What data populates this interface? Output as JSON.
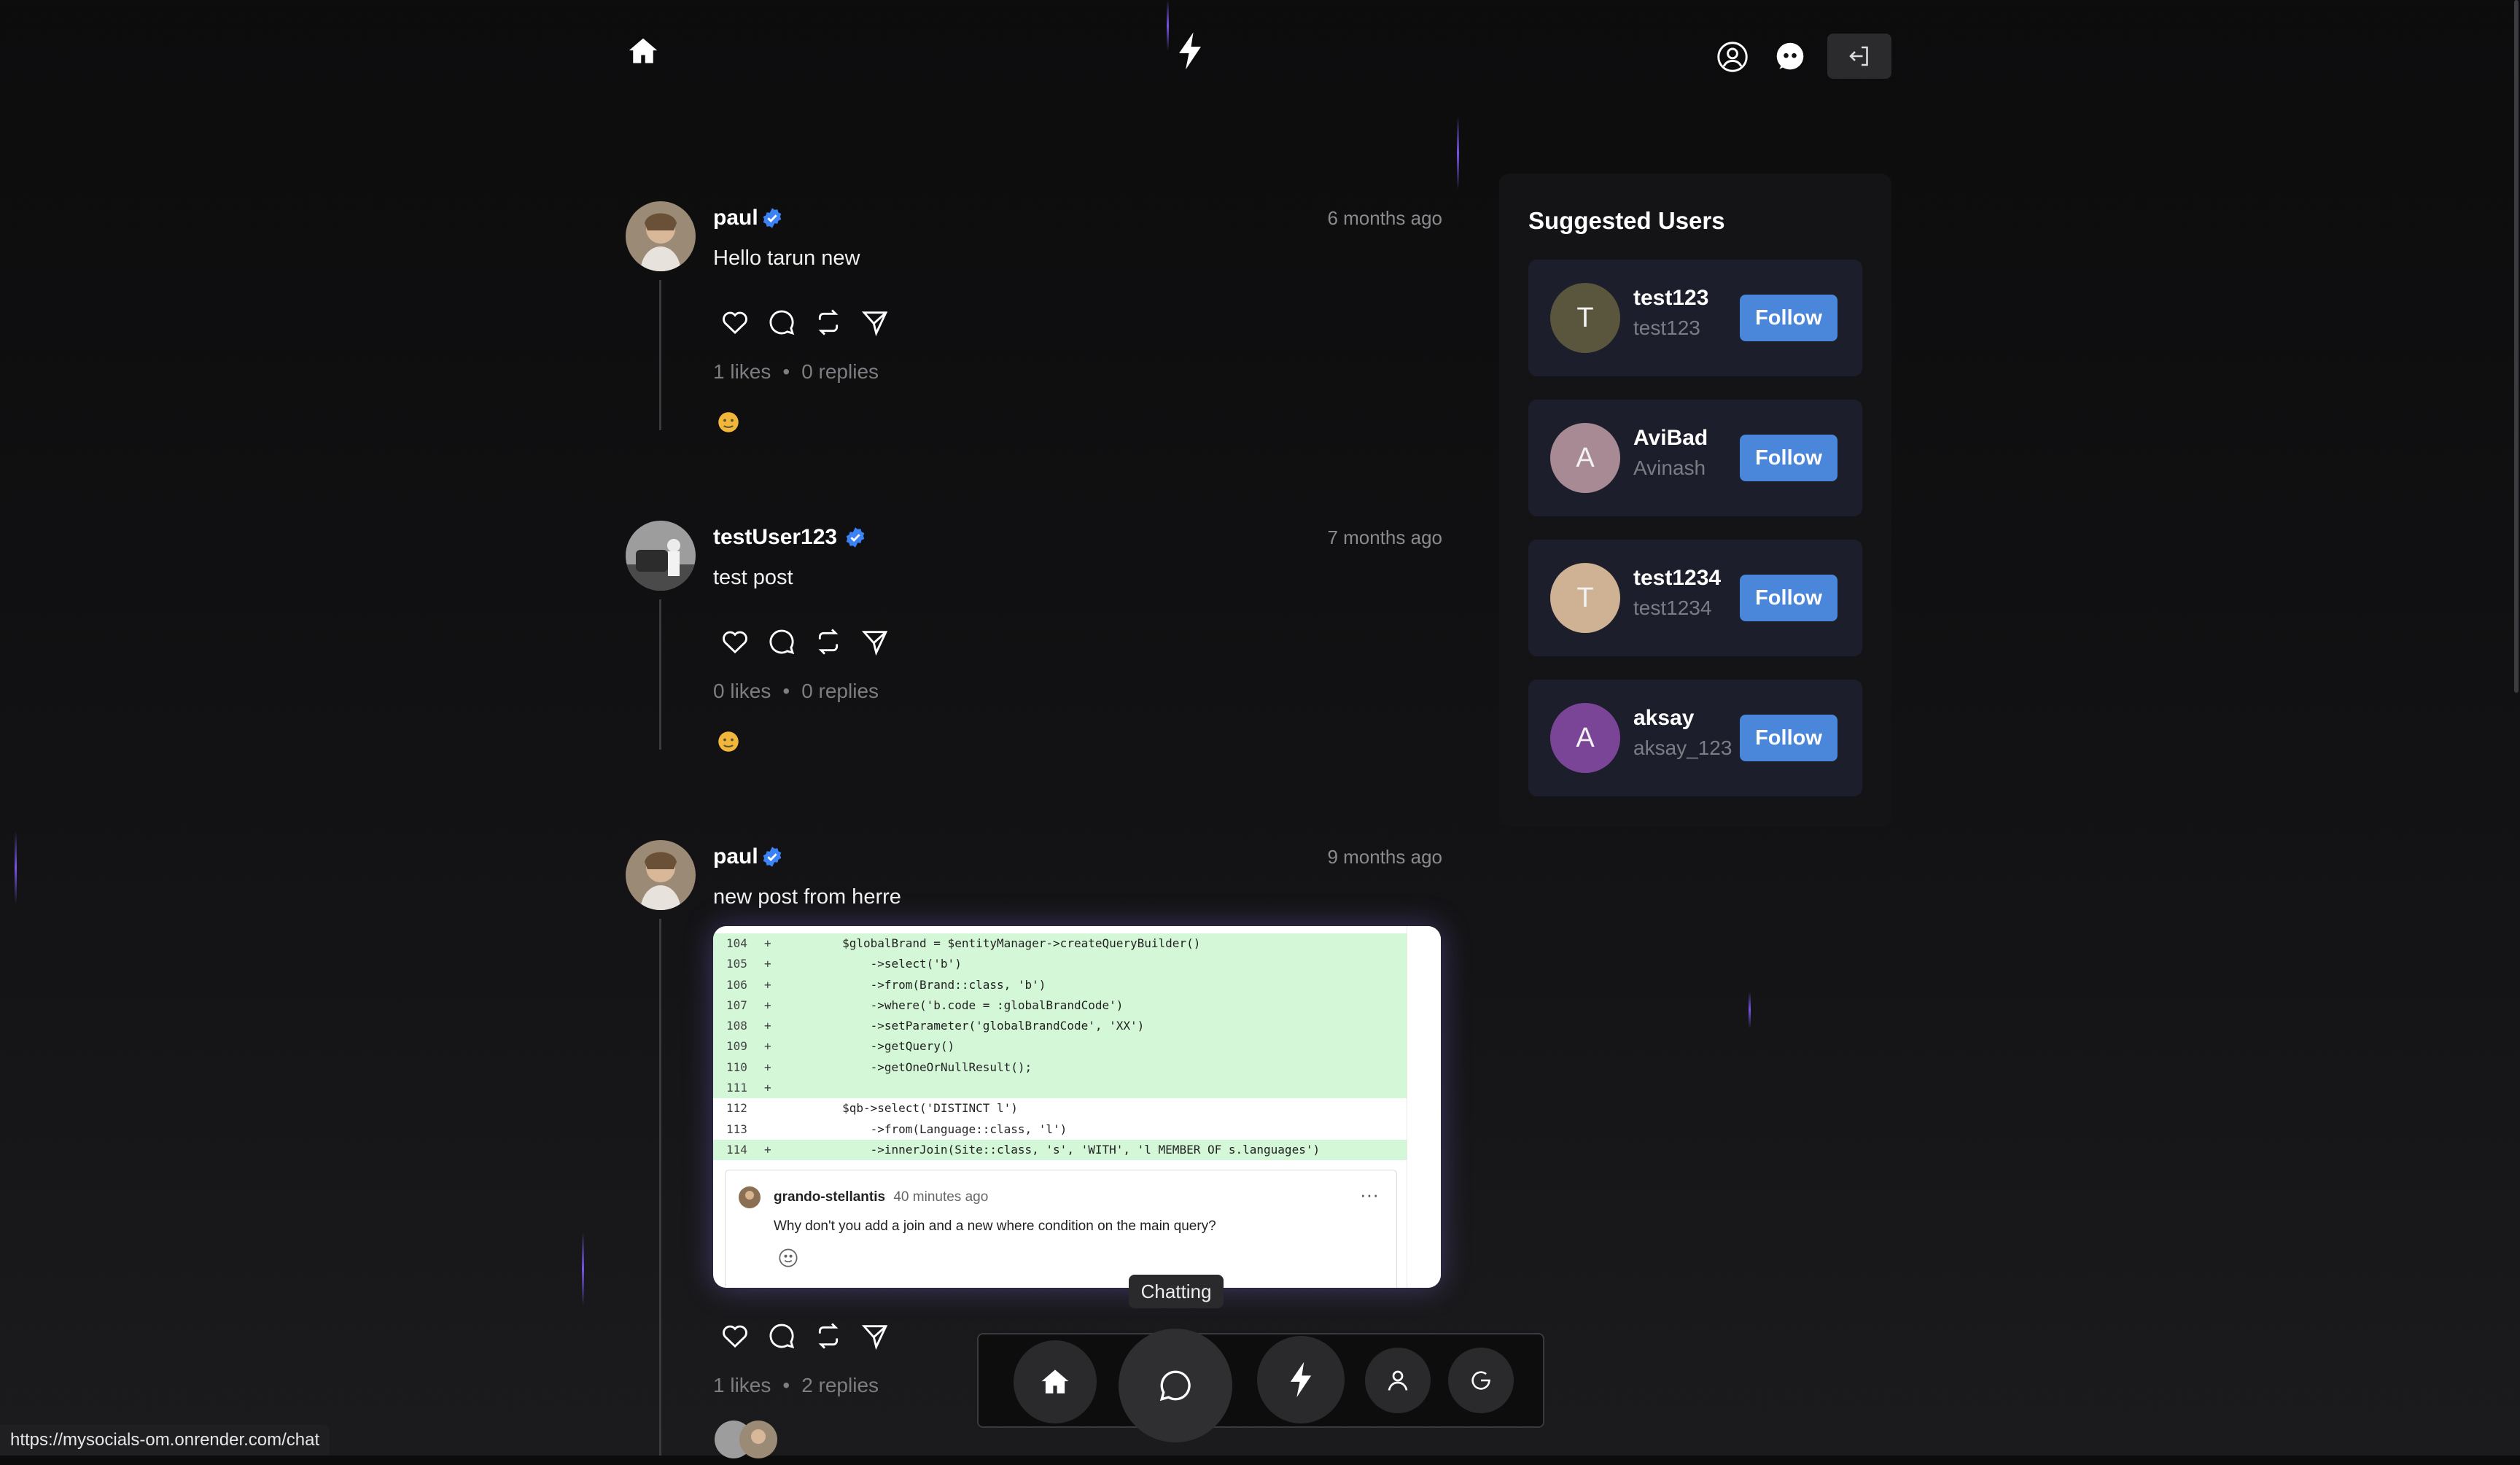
{
  "header": {
    "home_icon": "home-icon",
    "logo_icon": "lightning-icon",
    "profile_icon": "user-circle-icon",
    "chat_icon": "chat-bubbles-icon",
    "logout_icon": "logout-icon"
  },
  "posts": [
    {
      "username": "paul",
      "time": "6 months ago",
      "text": "Hello tarun new",
      "likes": "1 likes",
      "replies": "0 replies"
    },
    {
      "username": "testUser123",
      "time": "7 months ago",
      "text": "test post",
      "likes": "0 likes",
      "replies": "0 replies"
    },
    {
      "username": "paul",
      "time": "9 months ago",
      "text": "new post from herre",
      "likes": "1 likes",
      "replies": "2 replies",
      "image": {
        "code_lines": [
          {
            "n": "104",
            "pm": "+",
            "add": true,
            "code": "        $globalBrand = $entityManager->createQueryBuilder()"
          },
          {
            "n": "105",
            "pm": "+",
            "add": true,
            "code": "            ->select('b')"
          },
          {
            "n": "106",
            "pm": "+",
            "add": true,
            "code": "            ->from(Brand::class, 'b')"
          },
          {
            "n": "107",
            "pm": "+",
            "add": true,
            "code": "            ->where('b.code = :globalBrandCode')"
          },
          {
            "n": "108",
            "pm": "+",
            "add": true,
            "code": "            ->setParameter('globalBrandCode', 'XX')"
          },
          {
            "n": "109",
            "pm": "+",
            "add": true,
            "code": "            ->getQuery()"
          },
          {
            "n": "110",
            "pm": "+",
            "add": true,
            "code": "            ->getOneOrNullResult();"
          },
          {
            "n": "111",
            "pm": "+",
            "add": true,
            "code": ""
          },
          {
            "n": "112",
            "pm": "",
            "add": false,
            "code": "        $qb->select('DISTINCT l')"
          },
          {
            "n": "113",
            "pm": "",
            "add": false,
            "code": "            ->from(Language::class, 'l')"
          },
          {
            "n": "114",
            "pm": "+",
            "add": true,
            "code": "            ->innerJoin(Site::class, 's', 'WITH', 'l MEMBER OF s.languages')"
          }
        ],
        "comment_author": "grando-stellantis",
        "comment_time": "40 minutes ago",
        "comment_text": "Why don't you add a join and a new where condition on the main query?",
        "comment_menu": "···"
      }
    }
  ],
  "sidebar": {
    "title": "Suggested Users",
    "users": [
      {
        "initial": "T",
        "name": "test123",
        "handle": "test123",
        "follow": "Follow",
        "color": "#5a553d"
      },
      {
        "initial": "A",
        "name": "AviBad",
        "handle": "Avinash",
        "follow": "Follow",
        "color": "#a88a95"
      },
      {
        "initial": "T",
        "name": "test1234",
        "handle": "test1234",
        "follow": "Follow",
        "color": "#cfb193"
      },
      {
        "initial": "A",
        "name": "aksay",
        "handle": "aksay_123",
        "follow": "Follow",
        "color": "#7b4597"
      }
    ]
  },
  "bottom_nav": {
    "tooltip": "Chatting",
    "items": [
      "home-icon",
      "chat-icon",
      "lightning-icon",
      "user-icon",
      "logout-icon"
    ]
  },
  "status_url": "https://mysocials-om.onrender.com/chat",
  "colors": {
    "accent": "#4a86d9",
    "verified": "#3b82f6",
    "background": "#101012"
  }
}
